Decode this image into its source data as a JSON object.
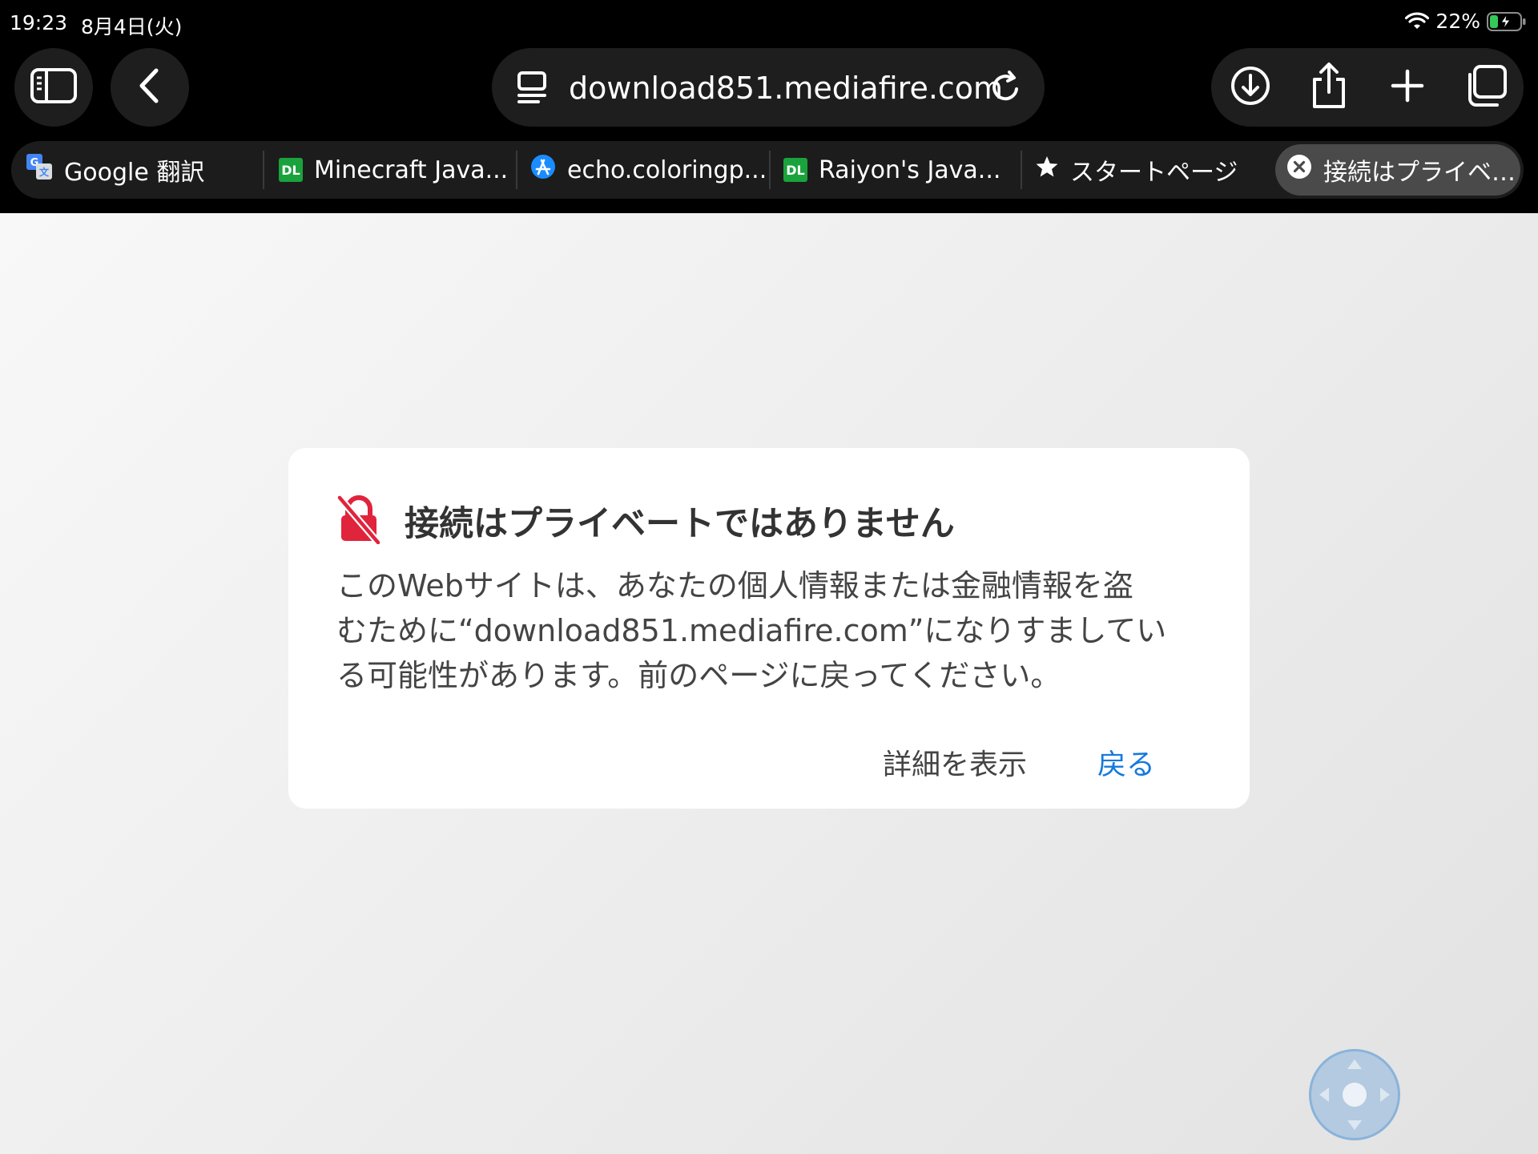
{
  "status_bar": {
    "time": "19:23",
    "date": "8月4日(火)",
    "battery": "22%"
  },
  "address_bar": {
    "url": "download851.mediafire.com"
  },
  "tabs": [
    {
      "label": "Google 翻訳",
      "icon": "google-translate-icon"
    },
    {
      "label": "Minecraft Java...",
      "icon": "dl-icon"
    },
    {
      "label": "echo.coloringp...",
      "icon": "app-store-icon"
    },
    {
      "label": "Raiyon's Java...",
      "icon": "dl-icon"
    },
    {
      "label": "スタートページ",
      "icon": "star-icon"
    },
    {
      "label": "接続はプライベ…",
      "icon": "close-icon",
      "active": true
    }
  ],
  "dl_badge": "DL",
  "dialog": {
    "title": "接続はプライベートではありません",
    "body_lines": [
      "このWebサイトは、あなたの個人情報または金融情報を盗",
      "むために“download851.mediafire.com”になりすましてい",
      "る可能性があります。前のページに戻ってください。"
    ],
    "details_label": "詳細を表示",
    "back_label": "戻る"
  },
  "colors": {
    "link_blue": "#1479de",
    "warning_red": "#e0243c",
    "battery_green": "#34c759"
  }
}
